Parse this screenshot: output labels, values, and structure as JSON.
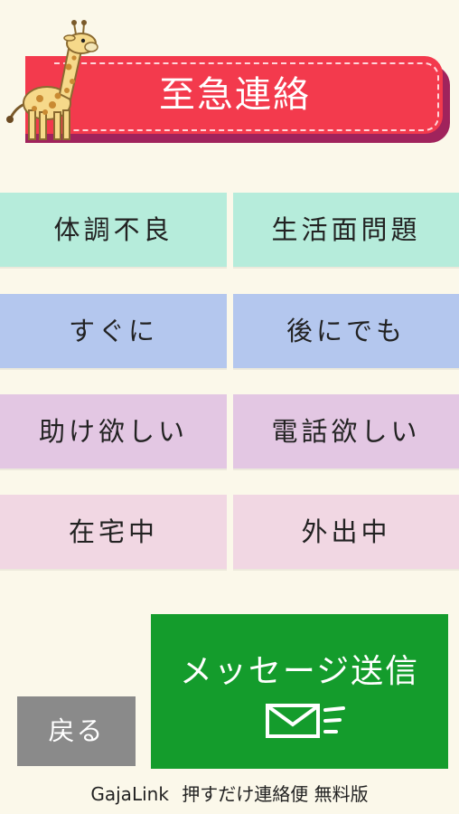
{
  "header": {
    "title": "至急連絡",
    "mascot_icon": "giraffe-icon"
  },
  "options": {
    "row1": {
      "left": "体調不良",
      "right": "生活面問題",
      "color": "#b6ecdb"
    },
    "row2": {
      "left": "すぐに",
      "right": "後にでも",
      "color": "#b4c7ee"
    },
    "row3": {
      "left": "助け欲しい",
      "right": "電話欲しい",
      "color": "#e3c7e3"
    },
    "row4": {
      "left": "在宅中",
      "right": "外出中",
      "color": "#f1d7e3"
    }
  },
  "buttons": {
    "back_label": "戻る",
    "send_label": "メッセージ送信",
    "send_icon": "mail-send-icon",
    "send_color": "#149c2c"
  },
  "footer": {
    "app_name": "GajaLink",
    "tagline": "押すだけ連絡便 無料版"
  },
  "colors": {
    "background": "#fbf8ea",
    "ribbon": "#f33a4d",
    "ribbon_shadow": "#a0235c"
  }
}
